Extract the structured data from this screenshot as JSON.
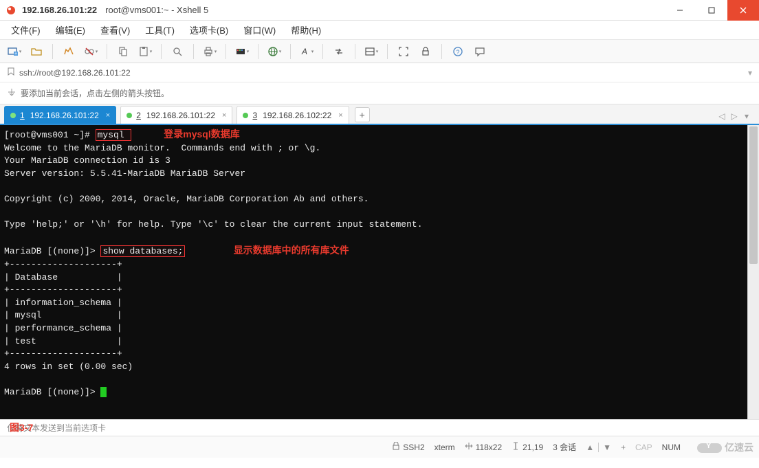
{
  "title": {
    "session": "192.168.26.101:22",
    "app": "root@vms001:~ - Xshell 5"
  },
  "window_buttons": {
    "minimize": "min",
    "maximize": "max",
    "close": "close"
  },
  "menus": [
    "文件(F)",
    "编辑(E)",
    "查看(V)",
    "工具(T)",
    "选项卡(B)",
    "窗口(W)",
    "帮助(H)"
  ],
  "toolbar_icons": [
    "new-session-icon",
    "open-session-icon",
    "sep",
    "reconnect-icon",
    "disconnect-icon",
    "sep",
    "copy-icon",
    "paste-icon",
    "sep",
    "search-icon",
    "sep",
    "print-icon",
    "sep",
    "color-scheme-icon",
    "sep",
    "language-icon",
    "sep",
    "font-icon",
    "sep",
    "transfer-icon",
    "sep",
    "panel-icon",
    "sep",
    "fullscreen-icon",
    "lock-icon",
    "sep",
    "help-icon",
    "feedback-icon"
  ],
  "address": {
    "icon": "bookmark-icon",
    "text": "ssh://root@192.168.26.101:22"
  },
  "hint": {
    "icon": "arrow-add-icon",
    "text": "要添加当前会话，点击左侧的箭头按钮。"
  },
  "tabs": [
    {
      "serial": "1",
      "label": "192.168.26.101:22",
      "active": true
    },
    {
      "serial": "2",
      "label": "192.168.26.101:22",
      "active": false
    },
    {
      "serial": "3",
      "label": "192.168.26.102:22",
      "active": false
    }
  ],
  "tab_add": "+",
  "tab_nav": {
    "left": "◁",
    "right": "▷",
    "menu": "▾"
  },
  "terminal": {
    "prompt1_pre": "[root@vms001 ~]# ",
    "prompt1_cmd": "mysql ",
    "anno1": "登录mysql数据库",
    "welcome_l1": "Welcome to the MariaDB monitor.  Commands end with ; or \\g.",
    "welcome_l2": "Your MariaDB connection id is 3",
    "welcome_l3": "Server version: 5.5.41-MariaDB MariaDB Server",
    "copyright": "Copyright (c) 2000, 2014, Oracle, MariaDB Corporation Ab and others.",
    "helpline": "Type 'help;' or '\\h' for help. Type '\\c' to clear the current input statement.",
    "prompt2_pre": "MariaDB [(none)]> ",
    "prompt2_cmd": "show databases;",
    "anno2": "显示数据库中的所有库文件",
    "table_border": "+--------------------+",
    "table_header": "| Database           |",
    "db1": "| information_schema |",
    "db2": "| mysql              |",
    "db3": "| performance_schema |",
    "db4": "| test               |",
    "rows_summary": "4 rows in set (0.00 sec)",
    "prompt3": "MariaDB [(none)]> "
  },
  "local_status": "仅将文本发送到当前选项卡",
  "figure_label": "图3-7",
  "statusbar": {
    "protocol": "SSH2",
    "term_type": "xterm",
    "size": "118x22",
    "cursor": "21,19",
    "sessions_label": "3 会话",
    "cap": "CAP",
    "num": "NUM"
  },
  "watermark": "亿速云"
}
